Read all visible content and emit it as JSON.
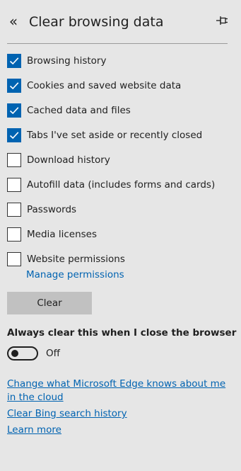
{
  "header": {
    "back_glyph": "«",
    "title": "Clear browsing data"
  },
  "options": [
    {
      "label": "Browsing history",
      "checked": true
    },
    {
      "label": "Cookies and saved website data",
      "checked": true
    },
    {
      "label": "Cached data and files",
      "checked": true
    },
    {
      "label": "Tabs I've set aside or recently closed",
      "checked": true
    },
    {
      "label": "Download history",
      "checked": false
    },
    {
      "label": "Autofill data (includes forms and cards)",
      "checked": false
    },
    {
      "label": "Passwords",
      "checked": false
    },
    {
      "label": "Media licenses",
      "checked": false
    },
    {
      "label": "Website permissions",
      "checked": false
    }
  ],
  "manage_permissions_label": "Manage permissions",
  "clear_button_label": "Clear",
  "always_clear": {
    "label": "Always clear this when I close the browser",
    "toggle_state": "Off",
    "enabled": false
  },
  "links": {
    "edge_knows": "Change what Microsoft Edge knows about me in the cloud",
    "bing_history": "Clear Bing search history",
    "learn_more": "Learn more"
  },
  "colors": {
    "background": "#e6e6e6",
    "accent": "#0063b1",
    "button": "#c1c1c1",
    "text": "#1f1f1f"
  },
  "icons": {
    "back": "double-chevron-left-icon",
    "pin": "pin-icon",
    "check": "checkmark-icon"
  }
}
